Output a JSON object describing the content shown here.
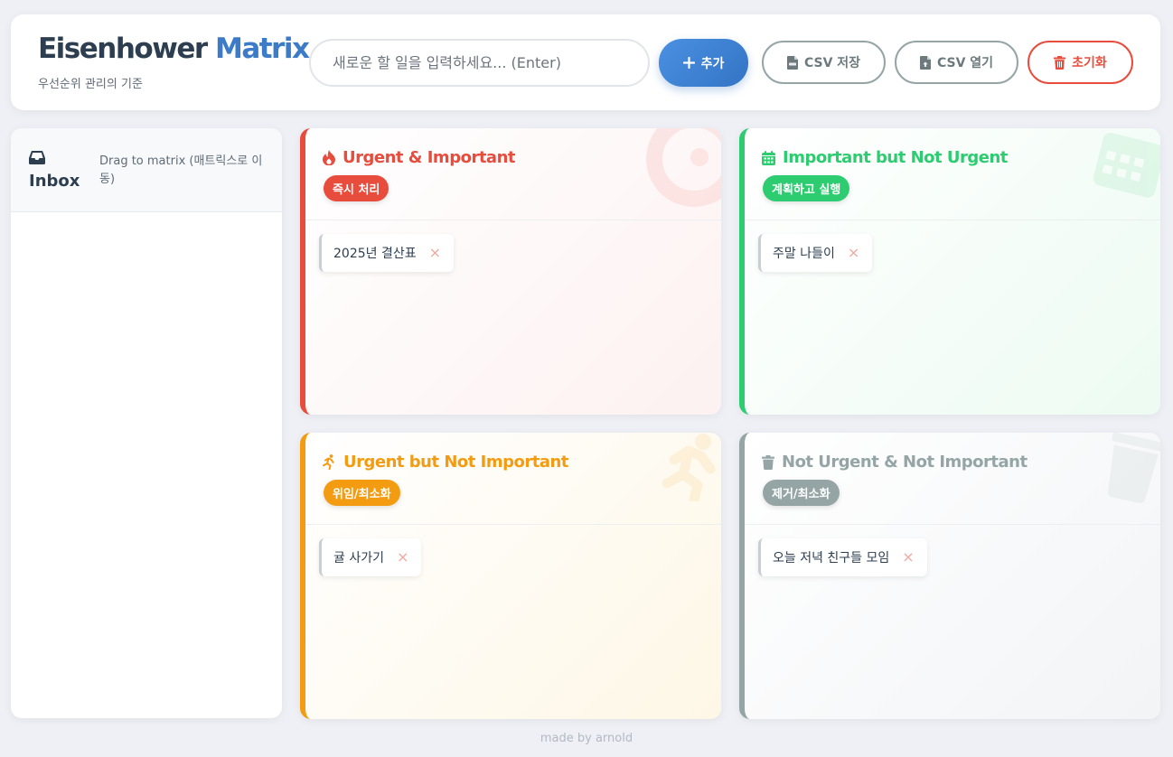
{
  "header": {
    "title_part1": "Eisenhower",
    "title_part2": "Matrix",
    "subtitle": "우선순위 관리의 기준",
    "input_placeholder": "새로운 할 일을 입력하세요... (Enter)",
    "add_label": "추가",
    "save_label": "CSV 저장",
    "open_label": "CSV 열기",
    "reset_label": "초기화"
  },
  "inbox": {
    "title": "Inbox",
    "hint": "Drag to matrix (매트릭스로 이동)",
    "items": []
  },
  "quadrants": [
    {
      "title": "Urgent & Important",
      "badge": "즉시 처리",
      "color": "#e74c3c",
      "icon": "fire-icon",
      "tasks": [
        "2025년 결산표"
      ]
    },
    {
      "title": "Important but Not Urgent",
      "badge": "계획하고 실행",
      "color": "#2ecc71",
      "icon": "calendar-icon",
      "tasks": [
        "주말 나들이"
      ]
    },
    {
      "title": "Urgent but Not Important",
      "badge": "위임/최소화",
      "color": "#f39c12",
      "icon": "running-icon",
      "tasks": [
        "귤 사가기"
      ]
    },
    {
      "title": "Not Urgent & Not Important",
      "badge": "제거/최소화",
      "color": "#95a5a6",
      "icon": "trash-icon",
      "tasks": [
        "오늘 저녁 친구들 모임"
      ]
    }
  ],
  "task_delete_symbol": "×",
  "footer": "made by arnold"
}
